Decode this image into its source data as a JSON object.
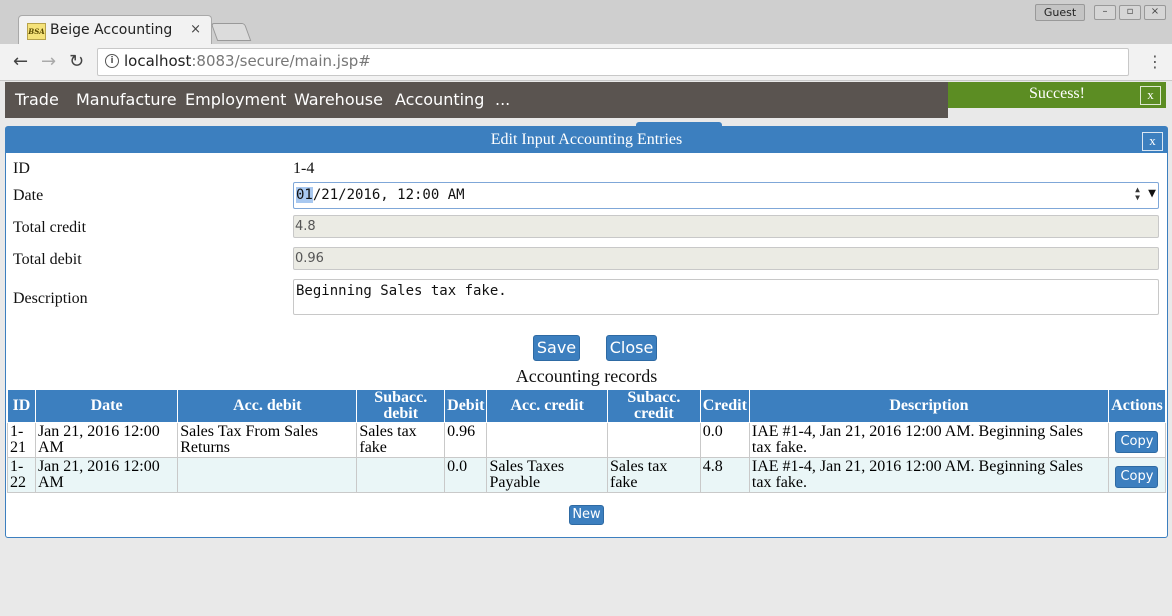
{
  "browser": {
    "tab_title": "Beige Accounting",
    "favicon_text": "BSA",
    "tab_close": "×",
    "profile": "Guest",
    "url_host": "localhost",
    "url_rest": ":8083/secure/main.jsp#"
  },
  "menu": {
    "items": [
      "Trade",
      "Manufacture",
      "Employment",
      "Warehouse",
      "Accounting",
      "..."
    ]
  },
  "notification": {
    "text": "Success!",
    "close": "x"
  },
  "dialog": {
    "title": "Edit Input Accounting Entries",
    "close": "x",
    "fields": {
      "id_label": "ID",
      "id_value": "1-4",
      "date_label": "Date",
      "date_month": "01",
      "date_rest": "/21/2016, 12:00 AM",
      "total_credit_label": "Total credit",
      "total_credit_value": "4.8",
      "total_debit_label": "Total debit",
      "total_debit_value": "0.96",
      "description_label": "Description",
      "description_value": "Beginning Sales tax fake."
    },
    "save_label": "Save",
    "close_label": "Close",
    "records_title": "Accounting records",
    "table": {
      "headers": [
        "ID",
        "Date",
        "Acc. debit",
        "Subacc. debit",
        "Debit",
        "Acc. credit",
        "Subacc. credit",
        "Credit",
        "Description",
        "Actions"
      ],
      "rows": [
        {
          "id": "1-21",
          "date": "Jan 21, 2016 12:00 AM",
          "acc_debit": "Sales Tax From Sales Returns",
          "subacc_debit": "Sales tax fake",
          "debit": "0.96",
          "acc_credit": "",
          "subacc_credit": "",
          "credit": "0.0",
          "description": "IAE #1-4, Jan 21, 2016 12:00 AM. Beginning Sales tax fake.",
          "action": "Copy"
        },
        {
          "id": "1-22",
          "date": "Jan 21, 2016 12:00 AM",
          "acc_debit": "",
          "subacc_debit": "",
          "debit": "0.0",
          "acc_credit": "Sales Taxes Payable",
          "subacc_credit": "Sales tax fake",
          "credit": "4.8",
          "description": "IAE #1-4, Jan 21, 2016 12:00 AM. Beginning Sales tax fake.",
          "action": "Copy"
        }
      ]
    },
    "new_label": "New"
  },
  "colors": {
    "accent": "#3c7fbf",
    "menubar": "#5a5450",
    "success": "#5c8d23",
    "row_alt": "#eaf6f7"
  }
}
